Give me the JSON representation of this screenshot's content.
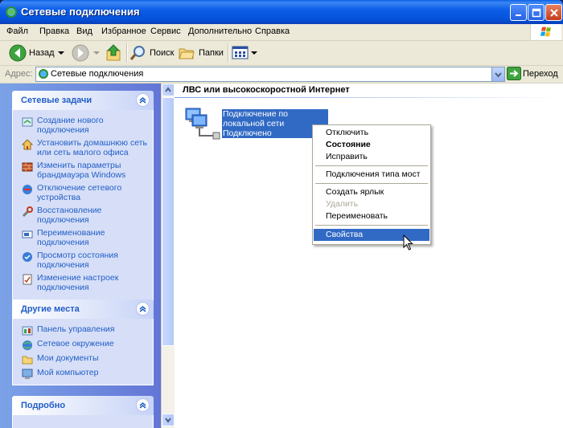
{
  "window": {
    "title": "Сетевые подключения"
  },
  "menu": [
    "Файл",
    "Правка",
    "Вид",
    "Избранное",
    "Сервис",
    "Дополнительно",
    "Справка"
  ],
  "toolbar": {
    "back": "Назад",
    "search": "Поиск",
    "folders": "Папки"
  },
  "address": {
    "label": "Адрес:",
    "value": "Сетевые подключения",
    "go": "Переход"
  },
  "network_tasks": {
    "title": "Сетевые задачи",
    "items": [
      "Создание нового подключения",
      "Установить домашнюю сеть или сеть малого офиса",
      "Изменить параметры брандмауэра Windows",
      "Отключение сетевого устройства",
      "Восстановление подключения",
      "Переименование подключения",
      "Просмотр состояния подключения",
      "Изменение настроек подключения"
    ]
  },
  "other_places": {
    "title": "Другие места",
    "items": [
      "Панель управления",
      "Сетевое окружение",
      "Мои документы",
      "Мой компьютер"
    ]
  },
  "details": {
    "title": "Подробно"
  },
  "content": {
    "category": "ЛВС или высокоскоростной Интернет",
    "connection": {
      "name": "Подключение по локальной сети",
      "status": "Подключено"
    }
  },
  "context_menu": {
    "items": [
      "Отключить",
      "Состояние",
      "Исправить",
      "Подключения типа мост",
      "Создать ярлык",
      "Удалить",
      "Переименовать",
      "Свойства"
    ],
    "default_item": "Состояние",
    "disabled_item": "Удалить",
    "selected_item": "Свойства"
  },
  "colors": {
    "titlebar": "#0c5ee8",
    "selection": "#316ac5",
    "task_link": "#215dc6"
  }
}
